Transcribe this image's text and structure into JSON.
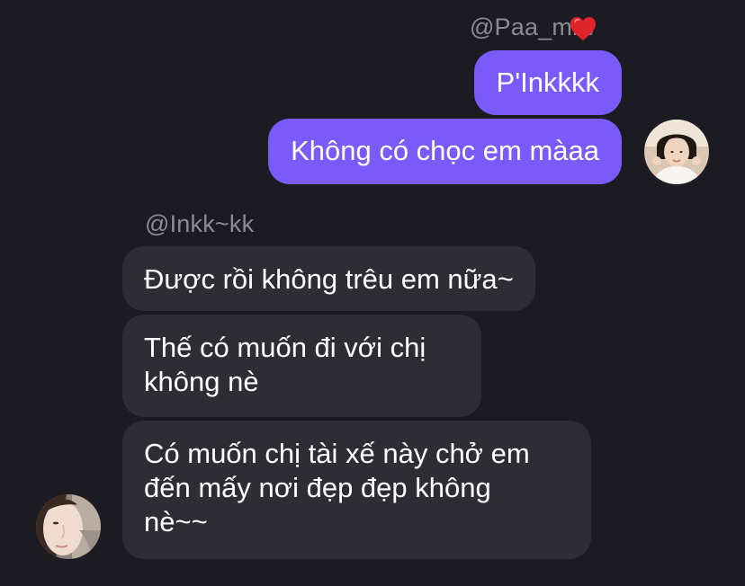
{
  "conversation": {
    "outgoing": {
      "sender": "@Paa_miw",
      "heart_icon": "red-heart-emoji",
      "messages": [
        {
          "lines": [
            "P'Inkkkk"
          ]
        },
        {
          "lines": [
            "Không có chọc em màaa"
          ]
        }
      ]
    },
    "incoming": {
      "sender": "@Inkk~kk",
      "messages": [
        {
          "lines": [
            "Được rồi không trêu em nữa~"
          ]
        },
        {
          "lines": [
            "Thế có muốn đi với chị",
            "không nè"
          ]
        },
        {
          "lines": [
            "Có muốn chị tài xế này chở em",
            "đến mấy nơi đẹp đẹp không",
            "nè~~"
          ]
        }
      ]
    }
  },
  "colors": {
    "background": "#1c1b21",
    "outgoing_bubble": "#7a5af8",
    "incoming_bubble": "#2e2d33",
    "sender_name": "#8d8c93"
  }
}
